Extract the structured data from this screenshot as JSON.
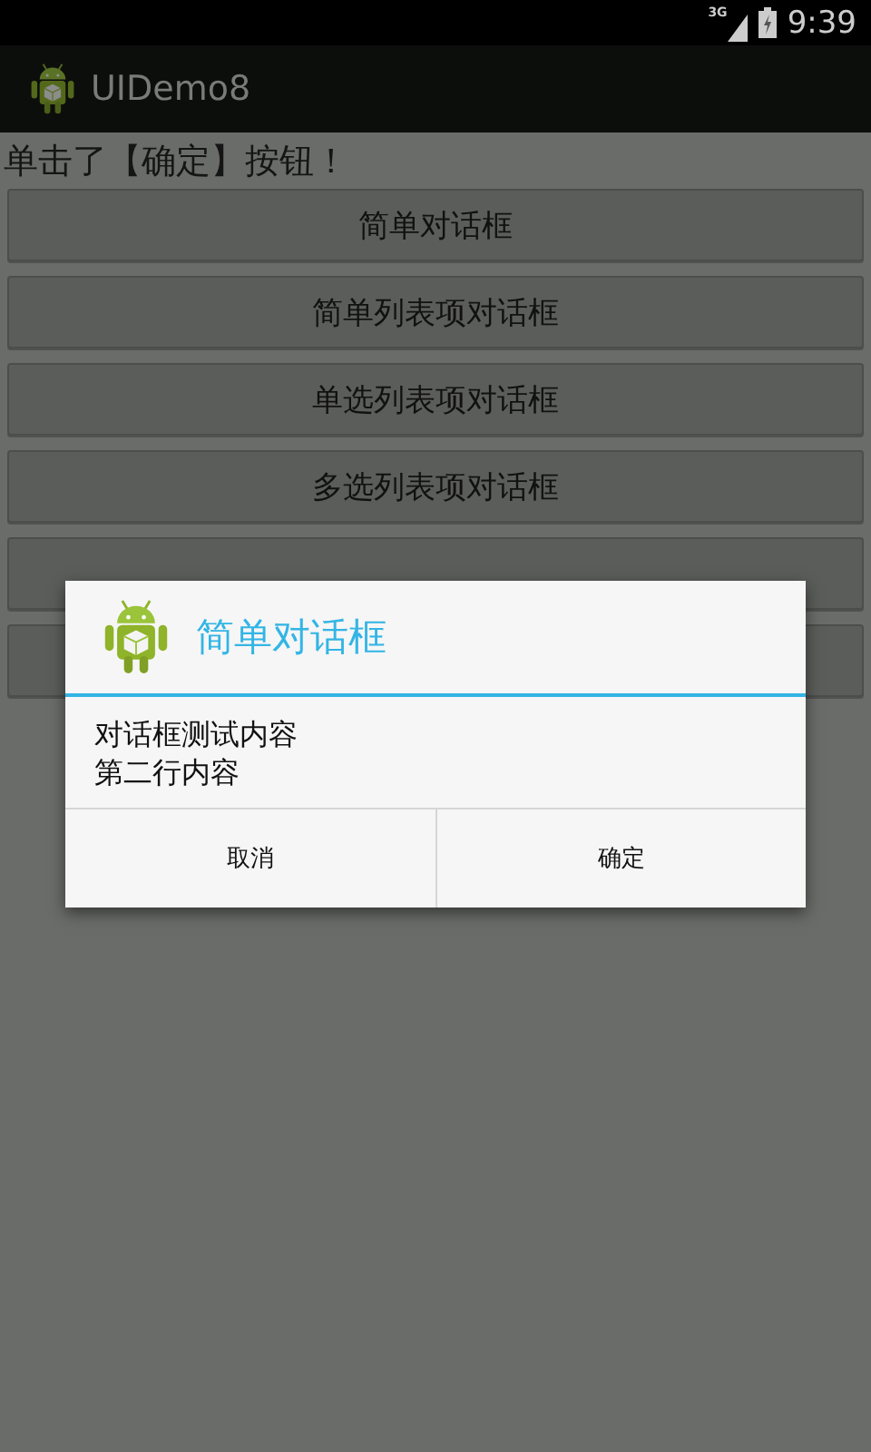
{
  "status_bar": {
    "network": "3G",
    "time": "9:39"
  },
  "action_bar": {
    "title": "UIDemo8"
  },
  "message": "单击了【确定】按钮！",
  "buttons": [
    {
      "kind": "labeled",
      "label": "简单对话框"
    },
    {
      "kind": "labeled",
      "label": "简单列表项对话框"
    },
    {
      "kind": "labeled",
      "label": "单选列表项对话框"
    },
    {
      "kind": "labeled",
      "label": "多选列表项对话框"
    },
    {
      "kind": "covered"
    },
    {
      "kind": "covered"
    }
  ],
  "dialog": {
    "title": "简单对话框",
    "lines": [
      "对话框测试内容",
      "第二行内容"
    ],
    "buttons": [
      "取消",
      "确定"
    ]
  }
}
